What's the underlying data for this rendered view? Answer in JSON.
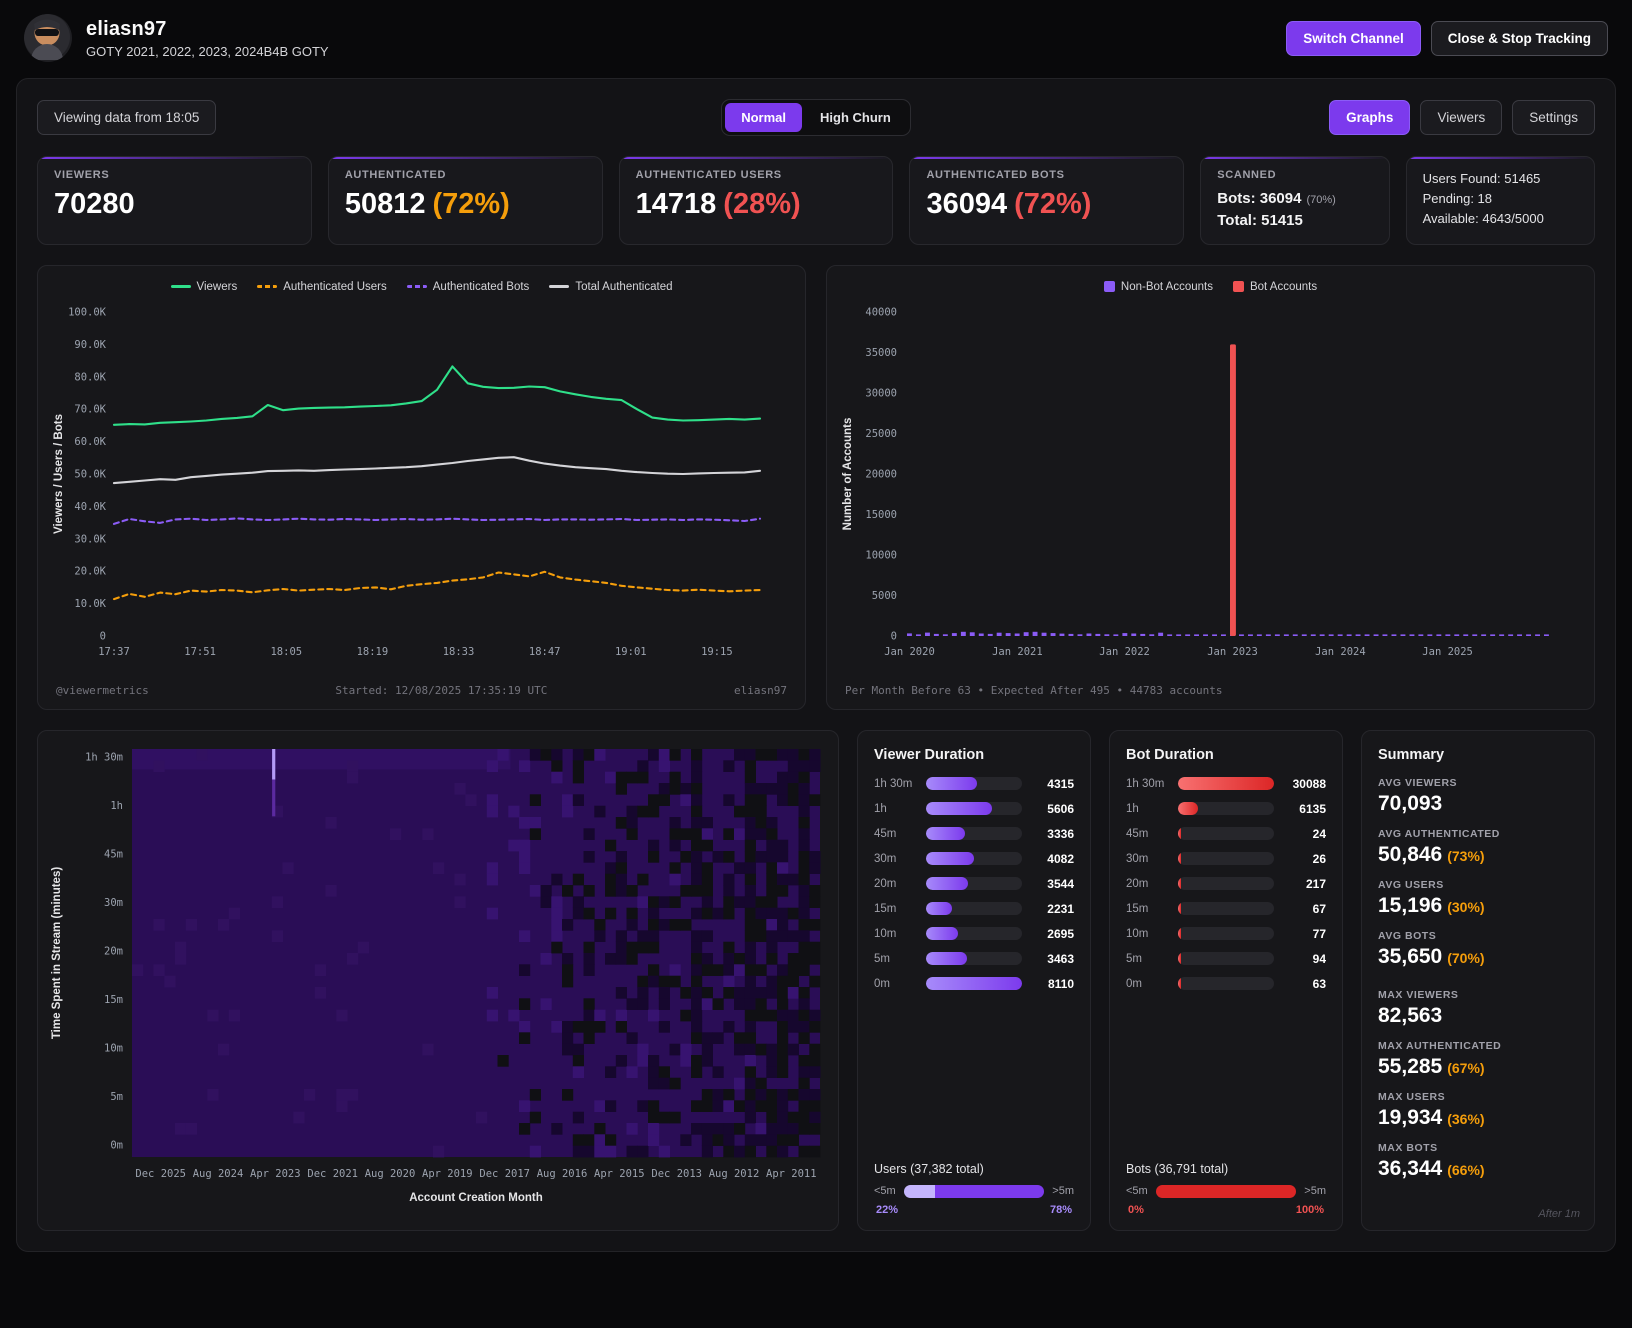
{
  "header": {
    "username": "eliasn97",
    "subtitle": "GOTY 2021, 2022, 2023, 2024B4B GOTY",
    "switch_channel": "Switch Channel",
    "close_stop": "Close & Stop Tracking"
  },
  "toolbar": {
    "viewing_data": "Viewing data from 18:05",
    "mode_normal": "Normal",
    "mode_high_churn": "High Churn",
    "tab_graphs": "Graphs",
    "tab_viewers": "Viewers",
    "tab_settings": "Settings"
  },
  "stat_cards": [
    {
      "label": "VIEWERS",
      "value": "70280",
      "pct": "",
      "pct_color": ""
    },
    {
      "label": "AUTHENTICATED",
      "value": "50812",
      "pct": "(72%)",
      "pct_color": "#f59e0b"
    },
    {
      "label": "AUTHENTICATED USERS",
      "value": "14718",
      "pct": "(28%)",
      "pct_color": "#f05252"
    },
    {
      "label": "AUTHENTICATED BOTS",
      "value": "36094",
      "pct": "(72%)",
      "pct_color": "#f05252"
    }
  ],
  "scanned_card": {
    "label": "SCANNED",
    "bots": "Bots: 36094",
    "bots_pct": "(70%)",
    "total": "Total: 51415"
  },
  "quota_card": {
    "users_found": "Users Found: 51465",
    "pending": "Pending: 18",
    "available": "Available: 4643/5000"
  },
  "chart_data": [
    {
      "type": "line",
      "ylabel": "Viewers / Users / Bots",
      "unit": "thousands",
      "ylim": [
        0,
        100
      ],
      "y_ticks": [
        "0",
        "10.0K",
        "20.0K",
        "30.0K",
        "40.0K",
        "50.0K",
        "60.0K",
        "70.0K",
        "80.0K",
        "90.0K",
        "100.0K"
      ],
      "x_ticks": [
        "17:37",
        "17:51",
        "18:05",
        "18:19",
        "18:33",
        "18:47",
        "19:01",
        "19:15"
      ],
      "x_tick_fracs": [
        0,
        0.1333,
        0.2667,
        0.4,
        0.5333,
        0.6667,
        0.8,
        0.9333
      ],
      "series": [
        {
          "name": "Viewers",
          "color": "#2fe08a",
          "dash": false,
          "values": [
            65.2,
            65.4,
            65.3,
            65.8,
            66,
            66.2,
            66.5,
            67,
            67.3,
            67.8,
            71.3,
            69.7,
            70.2,
            70.4,
            70.5,
            70.6,
            70.8,
            71,
            71.2,
            71.8,
            72.5,
            76,
            83.2,
            78,
            76.9,
            76.5,
            76.6,
            77,
            76.8,
            75.5,
            74.6,
            73.8,
            73.2,
            72.8,
            70,
            67.4,
            66.8,
            66.5,
            66.6,
            66.8,
            67,
            66.8,
            67.1
          ]
        },
        {
          "name": "Authenticated Users",
          "color": "#f59e0b",
          "dash": true,
          "values": [
            11.4,
            13,
            12.1,
            13.4,
            12.9,
            14,
            13.7,
            14.2,
            14,
            13.5,
            14.1,
            14.5,
            14,
            14.3,
            14.5,
            14.2,
            14.8,
            15,
            14.4,
            15.5,
            16,
            16.4,
            17.1,
            17.5,
            18.1,
            19.6,
            19,
            18.4,
            19.8,
            18.1,
            17.4,
            16.9,
            16.4,
            15.5,
            15,
            14.6,
            14.2,
            14,
            14.3,
            14,
            13.8,
            14,
            14.2
          ]
        },
        {
          "name": "Authenticated Bots",
          "color": "#8b5cf6",
          "dash": true,
          "values": [
            34.6,
            36.1,
            35.4,
            34.9,
            36,
            36.2,
            35.8,
            36,
            36.3,
            36,
            35.8,
            36,
            36.2,
            36,
            35.9,
            36.1,
            36,
            35.8,
            36,
            36.1,
            35.9,
            36,
            36.2,
            36,
            35.8,
            35.9,
            36,
            36.1,
            35.8,
            36,
            36,
            35.9,
            36,
            36.1,
            35.8,
            35.9,
            36,
            35.8,
            36,
            35.9,
            35.7,
            35.5,
            36.2
          ]
        },
        {
          "name": "Total Authenticated",
          "color": "#d4d4d8",
          "dash": false,
          "values": [
            47.2,
            47.6,
            48,
            48.4,
            48.2,
            49,
            49.4,
            49.8,
            50.1,
            50.4,
            50.9,
            51,
            51.1,
            51,
            51.2,
            51.4,
            51.5,
            51.7,
            51.9,
            52.1,
            52.4,
            52.9,
            53.4,
            54,
            54.5,
            55,
            55.2,
            54.1,
            53.2,
            52.6,
            52.1,
            51.8,
            51.5,
            51,
            50.6,
            50.3,
            50.1,
            50,
            50.2,
            50.3,
            50.4,
            50.5,
            51
          ]
        }
      ],
      "footer_left": "@viewermetrics",
      "footer_center": "Started: 12/08/2025 17:35:19 UTC",
      "footer_right": "eliasn97"
    },
    {
      "type": "bar",
      "ylabel": "Number of Accounts",
      "ylim": [
        0,
        40000
      ],
      "y_ticks": [
        "0",
        "5000",
        "10000",
        "15000",
        "20000",
        "25000",
        "30000",
        "35000",
        "40000"
      ],
      "x_ticks": [
        "Jan 2020",
        "Jan 2021",
        "Jan 2022",
        "Jan 2023",
        "Jan 2024",
        "Jan 2025"
      ],
      "x_tick_fracs": [
        0.007,
        0.174,
        0.34,
        0.507,
        0.674,
        0.84
      ],
      "legend": [
        {
          "name": "Non-Bot Accounts",
          "color": "#8b5cf6"
        },
        {
          "name": "Bot Accounts",
          "color": "#f05252"
        }
      ],
      "non_bot": [
        320,
        180,
        420,
        260,
        210,
        360,
        520,
        460,
        310,
        260,
        410,
        360,
        310,
        470,
        520,
        410,
        360,
        300,
        260,
        210,
        310,
        260,
        210,
        160,
        360,
        310,
        260,
        210,
        410,
        160,
        110,
        90,
        70,
        60,
        50,
        40,
        30,
        25,
        20,
        15,
        12,
        12,
        10,
        10,
        10,
        10,
        10,
        10,
        8,
        8,
        8,
        8,
        8,
        8,
        8,
        8,
        8,
        8,
        8,
        8,
        6,
        6,
        6,
        6,
        6,
        6,
        6,
        6,
        6,
        6,
        6,
        6
      ],
      "bot_accounts": [
        {
          "index": 36,
          "value": 36000
        }
      ],
      "footer": "Per Month Before 63 • Expected After 495 • 44783 accounts"
    },
    {
      "type": "heatmap",
      "ylabel": "Time Spent in Stream (minutes)",
      "xlabel": "Account Creation Month",
      "y_ticks": [
        "1h 30m",
        "1h",
        "45m",
        "30m",
        "20m",
        "15m",
        "10m",
        "5m",
        "0m"
      ],
      "x_ticks": [
        "Dec 2025",
        "Aug 2024",
        "Apr 2023",
        "Dec 2021",
        "Aug 2020",
        "Apr 2019",
        "Dec 2017",
        "Aug 2016",
        "Apr 2015",
        "Dec 2013",
        "Aug 2012",
        "Apr 2011"
      ],
      "base_color": "#2a0d56",
      "noise_dark": [
        "#16072e",
        "#101014"
      ],
      "noise_light": "#371370",
      "highlight": {
        "x_frac": 0.206,
        "color": "#b49bf7"
      }
    }
  ],
  "viewer_duration": {
    "title": "Viewer Duration",
    "bar_from": "#a78bfa",
    "bar_to": "#7c3aed",
    "rows": [
      {
        "label": "1h 30m",
        "value": 4315
      },
      {
        "label": "1h",
        "value": 5606
      },
      {
        "label": "45m",
        "value": 3336
      },
      {
        "label": "30m",
        "value": 4082
      },
      {
        "label": "20m",
        "value": 3544
      },
      {
        "label": "15m",
        "value": 2231
      },
      {
        "label": "10m",
        "value": 2695
      },
      {
        "label": "5m",
        "value": 3463
      },
      {
        "label": "0m",
        "value": 8110
      }
    ],
    "total_label": "Users (37,382 total)",
    "split": {
      "left_label": "<5m",
      "right_label": ">5m",
      "left_pct": 22,
      "left_color": "#c4b5fd",
      "right_color": "#7c3aed",
      "left_text": "22%",
      "right_text": "78%",
      "text_color": "#a78bfa"
    }
  },
  "bot_duration": {
    "title": "Bot Duration",
    "bar_from": "#f87171",
    "bar_to": "#dc2626",
    "rows": [
      {
        "label": "1h 30m",
        "value": 30088
      },
      {
        "label": "1h",
        "value": 6135
      },
      {
        "label": "45m",
        "value": 24
      },
      {
        "label": "30m",
        "value": 26
      },
      {
        "label": "20m",
        "value": 217
      },
      {
        "label": "15m",
        "value": 67
      },
      {
        "label": "10m",
        "value": 77
      },
      {
        "label": "5m",
        "value": 94
      },
      {
        "label": "0m",
        "value": 63
      }
    ],
    "total_label": "Bots (36,791 total)",
    "split": {
      "left_label": "<5m",
      "right_label": ">5m",
      "left_pct": 0,
      "left_color": "#f87171",
      "right_color": "#dc2626",
      "left_text": "0%",
      "right_text": "100%",
      "text_color": "#f05252"
    }
  },
  "summary": {
    "title": "Summary",
    "items": [
      {
        "label": "AVG VIEWERS",
        "value": "70,093",
        "pct": "",
        "pct_color": "",
        "spacer": false
      },
      {
        "label": "AVG AUTHENTICATED",
        "value": "50,846",
        "pct": "(73%)",
        "pct_color": "#f59e0b",
        "spacer": false
      },
      {
        "label": "AVG USERS",
        "value": "15,196",
        "pct": "(30%)",
        "pct_color": "#f59e0b",
        "spacer": false
      },
      {
        "label": "AVG BOTS",
        "value": "35,650",
        "pct": "(70%)",
        "pct_color": "#f59e0b",
        "spacer": false
      },
      {
        "label": "MAX VIEWERS",
        "value": "82,563",
        "pct": "",
        "pct_color": "",
        "spacer": true
      },
      {
        "label": "MAX AUTHENTICATED",
        "value": "55,285",
        "pct": "(67%)",
        "pct_color": "#f59e0b",
        "spacer": false
      },
      {
        "label": "MAX USERS",
        "value": "19,934",
        "pct": "(36%)",
        "pct_color": "#f59e0b",
        "spacer": false
      },
      {
        "label": "MAX BOTS",
        "value": "36,344",
        "pct": "(66%)",
        "pct_color": "#f59e0b",
        "spacer": false
      }
    ],
    "footnote": "After 1m"
  }
}
